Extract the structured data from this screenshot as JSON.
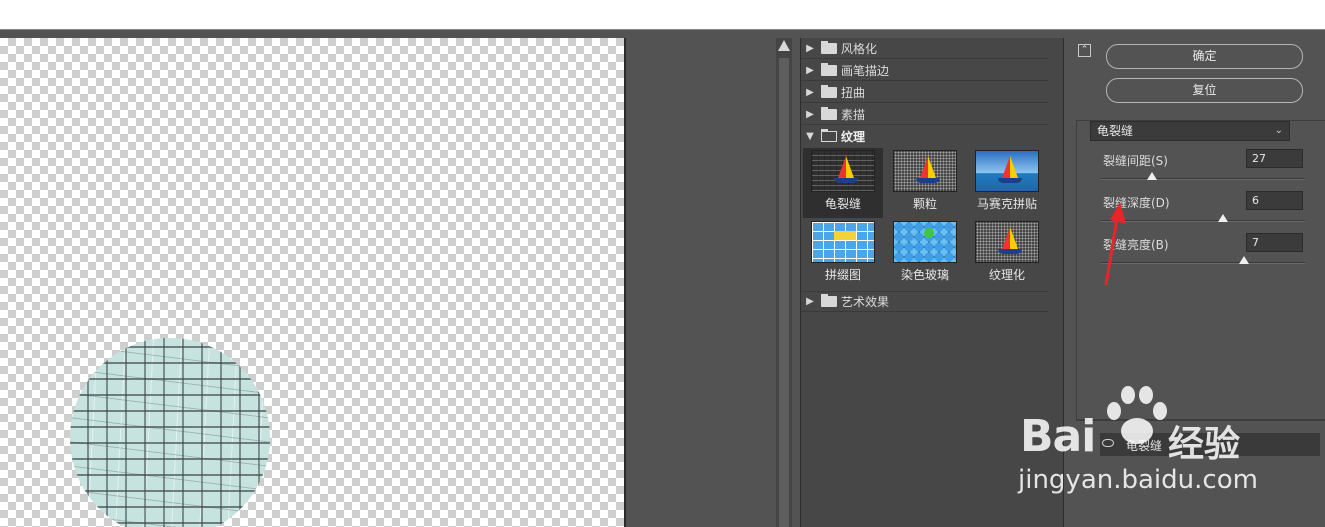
{
  "canvas": {
    "artwork_color": "#c6e3e0"
  },
  "filter_gallery": {
    "categories_before": [
      {
        "label": "风格化"
      },
      {
        "label": "画笔描边"
      },
      {
        "label": "扭曲"
      },
      {
        "label": "素描"
      }
    ],
    "open_category": {
      "label": "纹理"
    },
    "thumbnails": [
      {
        "label": "龟裂缝",
        "selected": true
      },
      {
        "label": "颗粒",
        "selected": false
      },
      {
        "label": "马赛克拼贴",
        "selected": false
      },
      {
        "label": "拼缀图",
        "selected": false
      },
      {
        "label": "染色玻璃",
        "selected": false
      },
      {
        "label": "纹理化",
        "selected": false
      }
    ],
    "categories_after": [
      {
        "label": "艺术效果"
      }
    ]
  },
  "panel": {
    "ok_label": "确定",
    "reset_label": "复位",
    "filter_select": "龟裂缝",
    "params": [
      {
        "label": "裂缝间距(S)",
        "value": "27",
        "fraction": 0.25
      },
      {
        "label": "裂缝深度(D)",
        "value": "6",
        "fraction": 0.6
      },
      {
        "label": "裂缝亮度(B)",
        "value": "7",
        "fraction": 0.7
      }
    ],
    "layer_label": "龟裂缝"
  },
  "watermark": {
    "brand": "Bai",
    "brand_cn": "经验",
    "url": "jingyan.baidu.com"
  }
}
